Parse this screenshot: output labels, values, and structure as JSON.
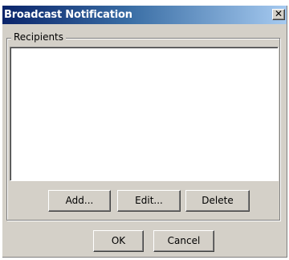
{
  "window": {
    "title": "Broadcast Notification",
    "close_label": "✕"
  },
  "recipients": {
    "group_label": "Recipients",
    "items": [],
    "buttons": {
      "add": "Add...",
      "edit": "Edit...",
      "delete": "Delete"
    }
  },
  "dialog_buttons": {
    "ok": "OK",
    "cancel": "Cancel"
  },
  "colors": {
    "titlebar_start": "#0a246a",
    "titlebar_end": "#a6caf0",
    "face": "#d4d0c8"
  }
}
